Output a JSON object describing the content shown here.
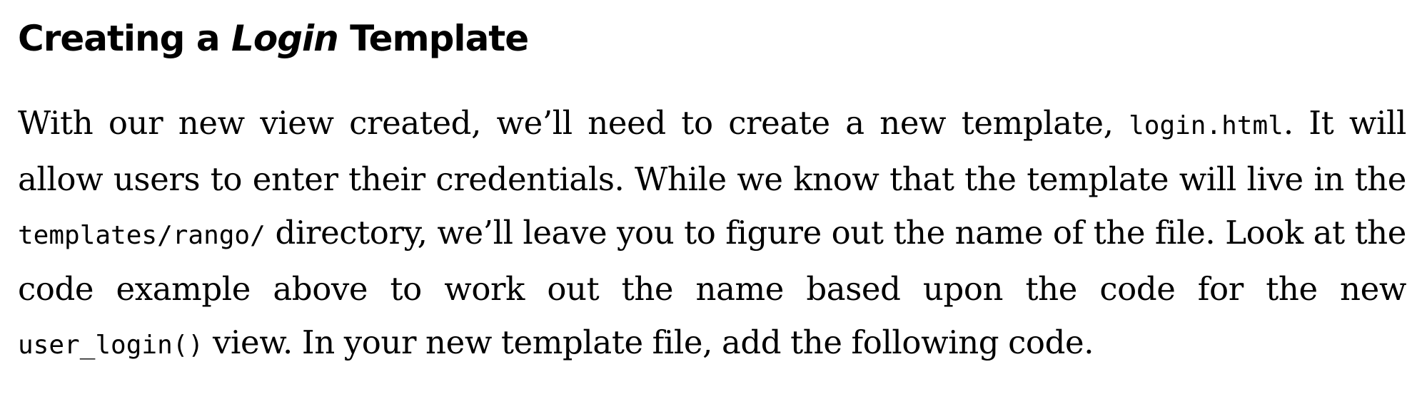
{
  "heading": {
    "part1": "Creating a ",
    "emphasis": "Login",
    "part2": " Template"
  },
  "paragraph": {
    "t1": "With our new view created, we’ll need to create a new template, ",
    "code1": "login.html",
    "t2": ". It will allow users to enter their credentials. While we know that the template will live in the ",
    "code2": "templates/rango/",
    "t3": " directory, we’ll leave you to figure out the name of the file. Look at the code example above to work out the name based upon the code for the new ",
    "code3": "user_login()",
    "t4": " view. In your new template file, add the following code."
  }
}
